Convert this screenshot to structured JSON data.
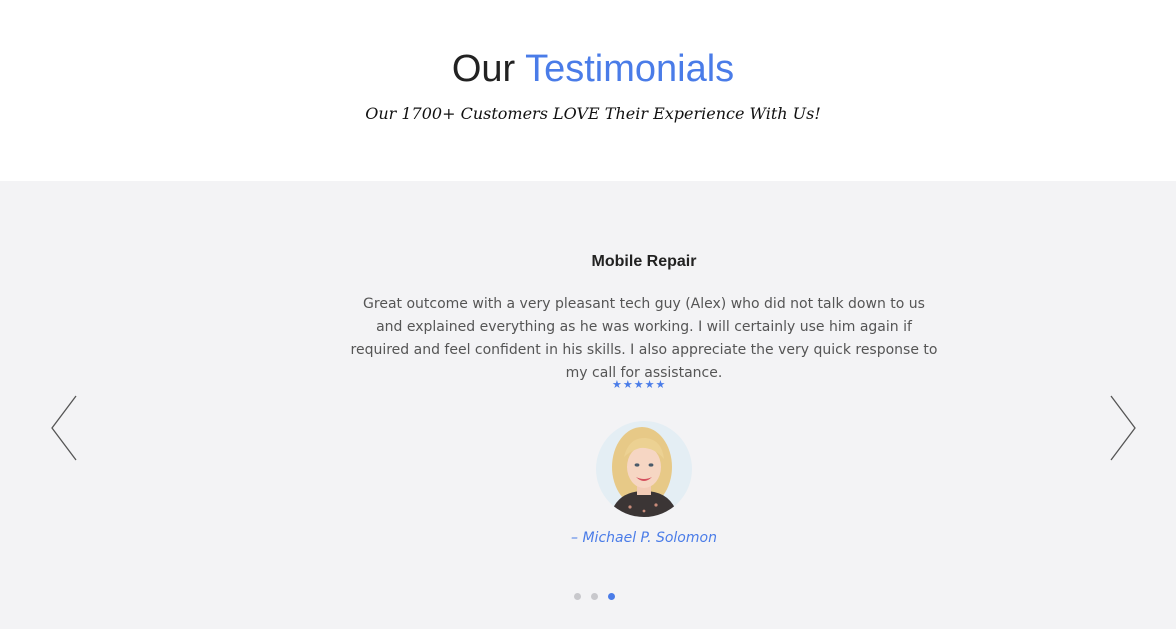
{
  "header": {
    "title_plain": "Our",
    "title_accent": "Testimonials",
    "subtitle": "Our 1700+ Customers LOVE Their Experience With Us!"
  },
  "testimonial": {
    "service": "Mobile Repair",
    "quote": "Great outcome with a very pleasant tech guy (Alex) who did not talk down to us and explained everything as he was working. I will certainly use him again if required and feel confident in his skills. I also appreciate the very quick response to my call for assistance.",
    "rating": 5,
    "star_glyph": "★",
    "author": "– Michael P. Solomon"
  },
  "carousel": {
    "slide_count": 3,
    "active_slide": 3,
    "prev_icon": "chevron-left-icon",
    "next_icon": "chevron-right-icon"
  },
  "colors": {
    "accent": "#4a7ce8",
    "band_background": "#f3f3f5",
    "inactive_dot": "#c8c8cc"
  }
}
